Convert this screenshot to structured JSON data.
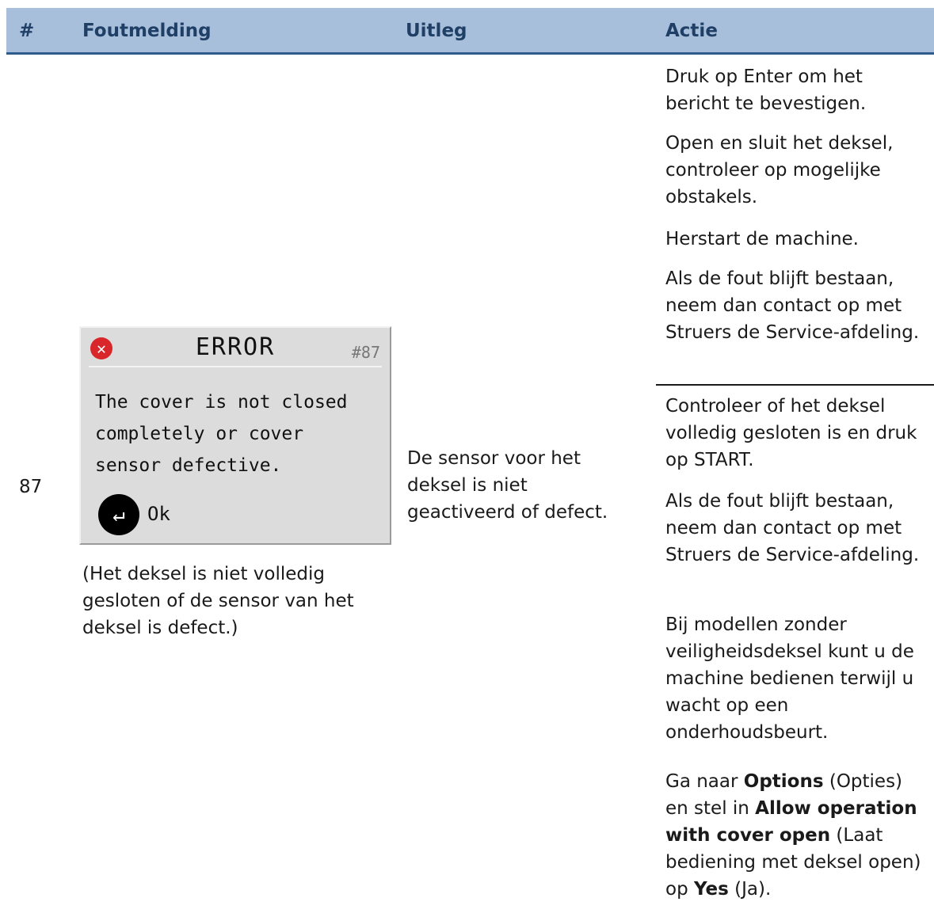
{
  "headers": {
    "num": "#",
    "foutmelding": "Foutmelding",
    "uitleg": "Uitleg",
    "actie": "Actie"
  },
  "row": {
    "number": "87",
    "screen": {
      "title": "ERROR",
      "code": "#87",
      "message": "The cover is not closed completely or cover sensor defective.",
      "ok_label": "Ok",
      "error_icon": "error-circle-icon",
      "enter_icon": "enter-key-icon"
    },
    "caption": "(Het deksel is niet volledig gesloten of de sensor van het deksel is defect.)",
    "uitleg": "De sensor voor het deksel is niet geactiveerd of defect.",
    "actions_1": [
      "Druk op Enter om het bericht te bevestigen.",
      "Open en sluit het deksel, controleer op mogelijke obstakels.",
      "Herstart de machine.",
      "Als de fout blijft bestaan, neem dan contact op met Struers de Service-afdeling."
    ],
    "actions_2": [
      "Controleer of het deksel volledig gesloten is en druk op START.",
      "Als de fout blijft bestaan, neem dan contact op met Struers de Service-afdeling.",
      "Bij modellen zonder veiligheidsdeksel kunt u de machine bedienen terwijl u wacht op een onderhoudsbeurt."
    ],
    "options_instruction": {
      "t1": "Ga naar ",
      "b1": "Options",
      "t2": " (Opties) en stel in ",
      "b2": "Allow operation with cover open",
      "t3": " (Laat bediening met deksel open) op ",
      "b3": "Yes",
      "t4": " (Ja)."
    }
  }
}
